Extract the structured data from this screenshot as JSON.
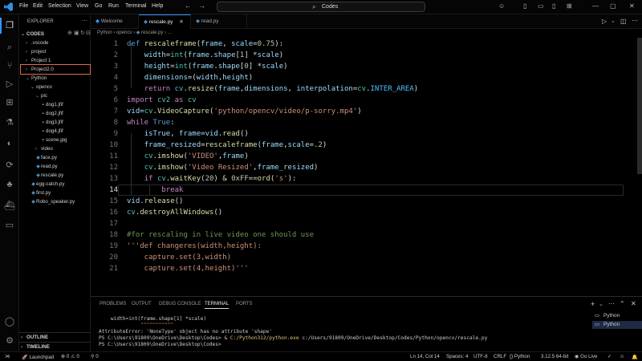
{
  "menu": [
    "File",
    "Edit",
    "Selection",
    "View",
    "Go",
    "Run",
    "Terminal",
    "Help"
  ],
  "command_center": "Codes",
  "sidebar": {
    "header": "EXPLORER",
    "root": "CODES",
    "items": [
      {
        "label": ".vscode",
        "kind": "folder"
      },
      {
        "label": "project",
        "kind": "folder"
      },
      {
        "label": "Project 1",
        "kind": "folder"
      },
      {
        "label": "Project2.0",
        "kind": "folder"
      },
      {
        "label": "Python",
        "kind": "folder-open"
      },
      {
        "label": "opencv",
        "kind": "folder-open"
      },
      {
        "label": "pic",
        "kind": "folder-open"
      },
      {
        "label": "dog1.jfif",
        "kind": "image"
      },
      {
        "label": "dog2.jfif",
        "kind": "image"
      },
      {
        "label": "dog3.jfif",
        "kind": "image"
      },
      {
        "label": "dog4.jfif",
        "kind": "image"
      },
      {
        "label": "scene.jpg",
        "kind": "image"
      },
      {
        "label": "video",
        "kind": "folder"
      },
      {
        "label": "face.py",
        "kind": "python"
      },
      {
        "label": "read.py",
        "kind": "python"
      },
      {
        "label": "rescale.py",
        "kind": "python"
      },
      {
        "label": "egg-catch.py",
        "kind": "python"
      },
      {
        "label": "first.py",
        "kind": "python"
      },
      {
        "label": "Robo_speaker.py",
        "kind": "python"
      }
    ],
    "outline": "OUTLINE",
    "timeline": "TIMELINE"
  },
  "tabs": [
    {
      "label": "Welcome"
    },
    {
      "label": "rescale.py",
      "active": true
    },
    {
      "label": "read.py"
    }
  ],
  "breadcrumbs": [
    "Python",
    "opencv",
    "rescale.py",
    "..."
  ],
  "editor": {
    "line_numbers": [
      "1",
      "2",
      "3",
      "4",
      "5",
      "6",
      "7",
      "8",
      "9",
      "10",
      "11",
      "12",
      "13",
      "14",
      "15",
      "16",
      "17",
      "18",
      "19",
      "20",
      "21"
    ],
    "current_line": "14"
  },
  "panel": {
    "tabs": [
      "PROBLEMS",
      "OUTPUT",
      "DEBUG CONSOLE",
      "TERMINAL",
      "PORTS"
    ],
    "active_tab": "TERMINAL",
    "terminal_lines": [
      "    width=int(frame.shape[1] *scale)",
      "              ^^^^^^^^^^^",
      "AttributeError: 'NoneType' object has no attribute 'shape'",
      "PS C:\\Users\\91809\\OneDrive\\Desktop\\Codes> & C:/Python312/python.exe c:/Users/91809/OneDrive/Desktop/Codes/Python/opencv/rescale.py",
      "PS C:\\Users\\91809\\OneDrive\\Desktop\\Codes> "
    ],
    "terminals": [
      "Python",
      "Python"
    ]
  },
  "status": {
    "launchpad": "Launchpad",
    "errors": "0",
    "warnings": "0",
    "ports": "0",
    "cursor": "Ln 14, Col 14",
    "spaces": "Spaces: 4",
    "encoding": "UTF-8",
    "eol": "CRLF",
    "language": "Python",
    "interpreter": "3.12.5 64-bit",
    "golive": "Go Live"
  },
  "colors": {
    "accent": "#3794ff",
    "selection_outline": "#e06c4c",
    "keyword": "#c586c0",
    "string": "#ce9178"
  }
}
